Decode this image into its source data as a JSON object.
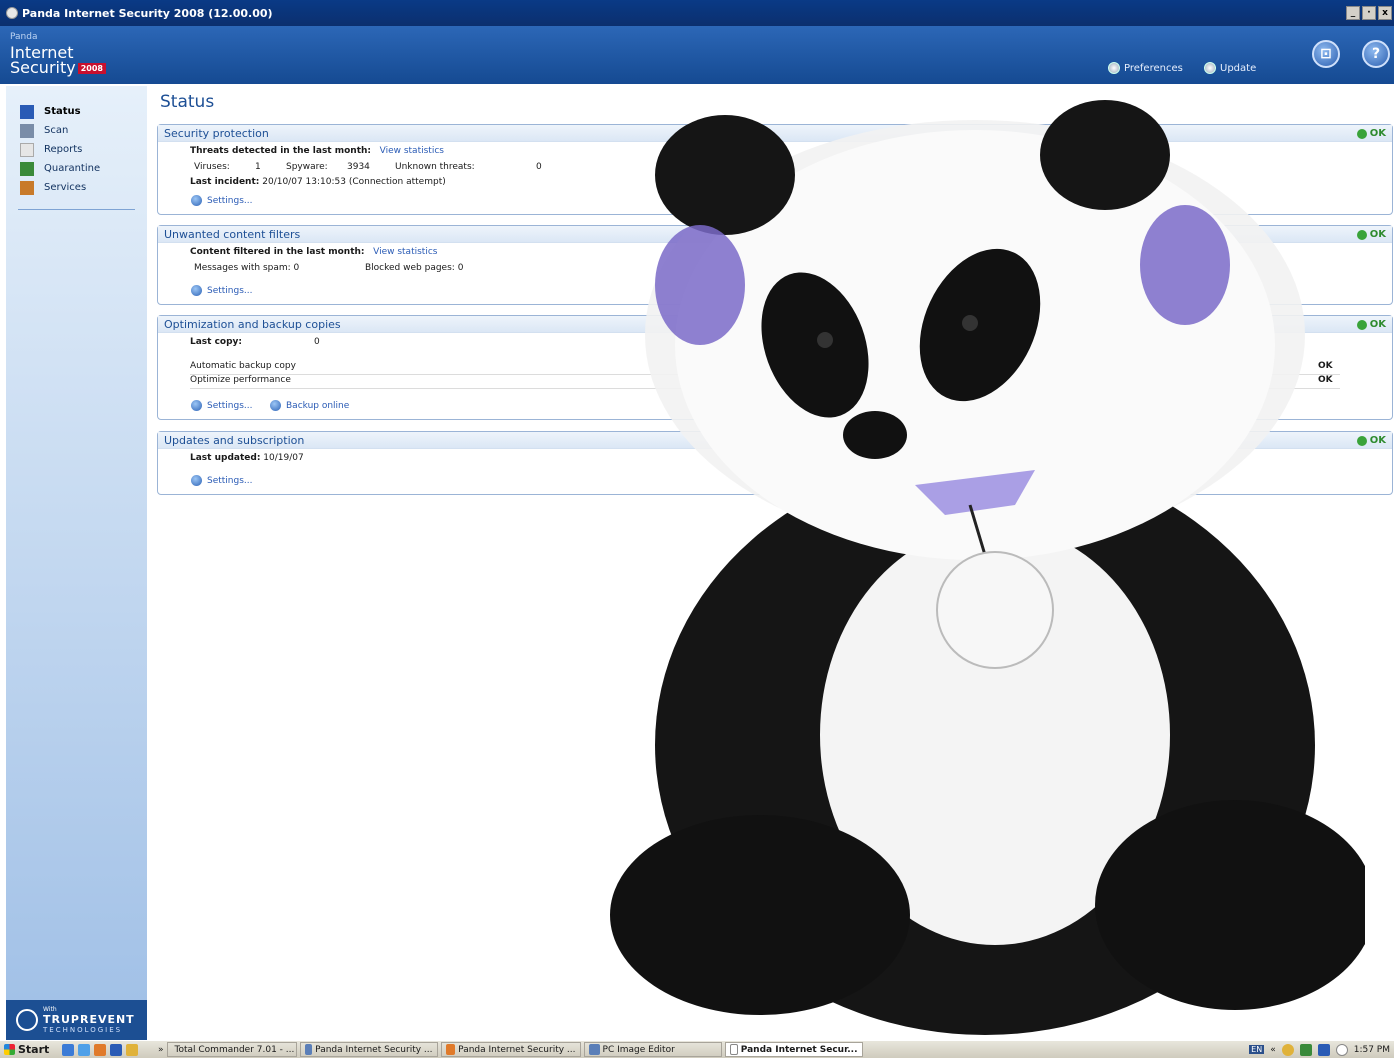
{
  "window": {
    "title": "Panda Internet Security 2008 (12.00.00)",
    "buttons": [
      "_",
      "·",
      "x"
    ]
  },
  "brand": {
    "line1": "Panda",
    "line2": "Internet",
    "line3": "Security",
    "year": "2008"
  },
  "header": {
    "preferences": "Preferences",
    "update": "Update",
    "store_glyph": "⊡",
    "help_glyph": "?"
  },
  "sidebar": {
    "items": [
      {
        "label": "Status",
        "icon": "status-icon",
        "color": "#2a5bb5"
      },
      {
        "label": "Scan",
        "icon": "scan-icon",
        "color": "#7a8da8"
      },
      {
        "label": "Reports",
        "icon": "reports-icon",
        "color": "#e6e6e6"
      },
      {
        "label": "Quarantine",
        "icon": "quarantine-icon",
        "color": "#3a8a3a"
      },
      {
        "label": "Services",
        "icon": "services-icon",
        "color": "#c87a2a"
      }
    ],
    "footer_badge": "With",
    "footer_title": "TRUPREVENT",
    "footer_sub": "TECHNOLOGIES"
  },
  "page_title": "Status",
  "ok_label": "OK",
  "settings_label": "Settings...",
  "security": {
    "title": "Security protection",
    "threats_label": "Threats detected in the last month:",
    "view_stats": "View statistics",
    "viruses_label": "Viruses:",
    "viruses_value": "1",
    "spyware_label": "Spyware:",
    "spyware_value": "3934",
    "unknown_label": "Unknown threats:",
    "unknown_value": "0",
    "incident_label": "Last incident:",
    "incident_value": "20/10/07 13:10:53 (Connection attempt)"
  },
  "content_filters": {
    "title": "Unwanted content filters",
    "filtered_label": "Content filtered in the last month:",
    "view_stats": "View statistics",
    "spam_label": "Messages with spam:",
    "spam_value": "0",
    "blocked_label": "Blocked web pages:",
    "blocked_value": "0"
  },
  "backup": {
    "title": "Optimization and backup copies",
    "last_copy_label": "Last copy:",
    "last_copy_value": "0",
    "auto_backup_label": "Automatic backup copy",
    "auto_backup_status": "OK",
    "optimize_label": "Optimize performance",
    "optimize_status": "OK",
    "backup_online": "Backup online"
  },
  "updates": {
    "title": "Updates and subscription",
    "last_updated_label": "Last updated:",
    "last_updated_value": "10/19/07"
  },
  "taskbar": {
    "start": "Start",
    "overflow": "»",
    "tasks": [
      {
        "label": "Total Commander 7.01 - ...",
        "active": false
      },
      {
        "label": "Panda Internet Security ...",
        "active": false
      },
      {
        "label": "Panda Internet Security ...",
        "active": false
      },
      {
        "label": "PC Image Editor",
        "active": false
      },
      {
        "label": "Panda Internet Secur...",
        "active": true
      }
    ],
    "lang": "EN",
    "tray_overflow": "«",
    "clock": "1:57 PM"
  }
}
